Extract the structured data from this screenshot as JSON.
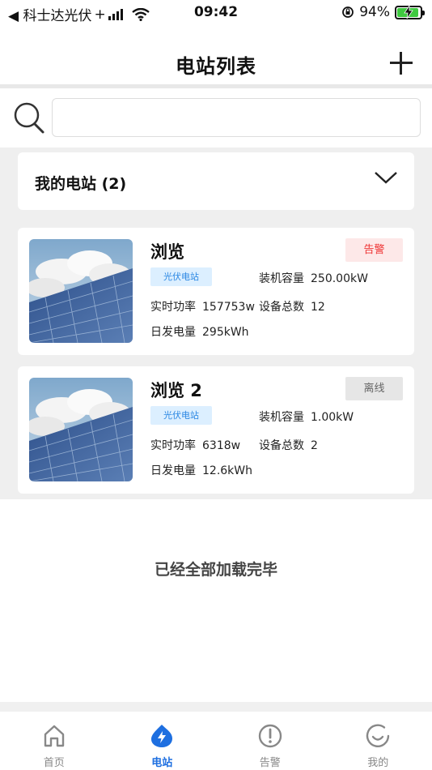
{
  "status_bar": {
    "back_app": "◀ 科士达光伏",
    "signal_plus": "+",
    "time": "09:42",
    "battery": "94%",
    "battery_level": 0.94,
    "battery_color": "#3fc940"
  },
  "header": {
    "title": "电站列表",
    "add_icon": "plus-icon"
  },
  "search": {
    "icon": "search-icon",
    "value": "",
    "placeholder": ""
  },
  "group": {
    "title": "我的电站 (2)",
    "expand_icon": "chevron-down-icon"
  },
  "stations": [
    {
      "name": "浏览",
      "status": "告警",
      "type": "光伏电站",
      "capacity_label": "装机容量",
      "capacity": "250.00kW",
      "power_label": "实时功率",
      "power": "157753w",
      "devices_label": "设备总数",
      "devices": "12",
      "energy_label": "日发电量",
      "energy": "295kWh"
    },
    {
      "name": "浏览 2",
      "status": "离线",
      "type": "光伏电站",
      "capacity_label": "装机容量",
      "capacity": "1.00kW",
      "power_label": "实时功率",
      "power": "6318w",
      "devices_label": "设备总数",
      "devices": "2",
      "energy_label": "日发电量",
      "energy": "12.6kWh"
    }
  ],
  "footer_text": "已经全部加载完毕",
  "tabs": [
    {
      "label": "首页",
      "icon": "home-icon",
      "active": false
    },
    {
      "label": "电站",
      "icon": "station-bolt-icon",
      "active": true
    },
    {
      "label": "告警",
      "icon": "alert-icon",
      "active": false
    },
    {
      "label": "我的",
      "icon": "profile-icon",
      "active": false
    }
  ],
  "colors": {
    "accent": "#1e6fe0",
    "alarm_text": "#e33333",
    "alarm_bg": "#fde8e8",
    "offline_bg": "#e6e6e6",
    "type_tag_bg": "#dcefff",
    "type_tag_text": "#2b87e3"
  }
}
